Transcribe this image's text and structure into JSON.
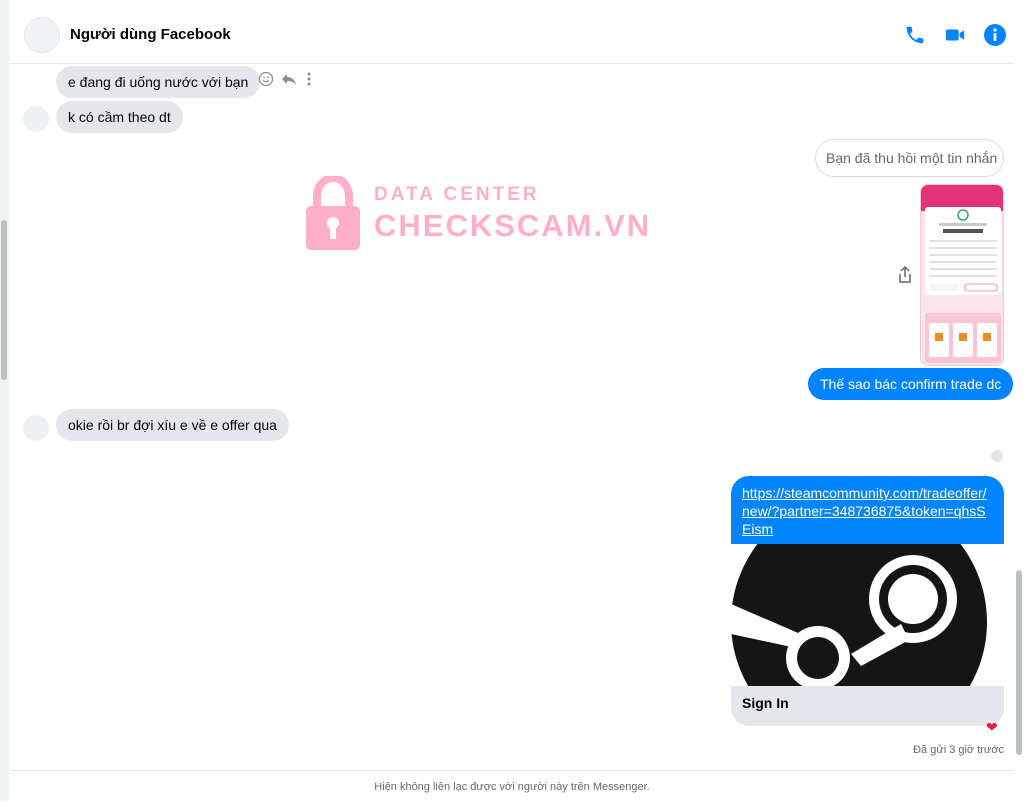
{
  "header": {
    "title": "Người dùng Facebook",
    "icons": [
      "phone-icon",
      "video-icon",
      "info-icon"
    ],
    "accent": "#0084ff"
  },
  "messages": {
    "m1": "e đang đi uống nước với bạn",
    "m2": "k có cầm theo dt",
    "recalled": "Bạn đã thu hồi một tin nhắn",
    "m3": "Thế sao bác confirm trade dc",
    "m4": "okie rồi br đợi xíu e về e offer qua"
  },
  "link_card": {
    "url": "https://steamcommunity.com/tradeoffer/new/?partner=348736875&token=qhsSEism",
    "caption": "Sign In"
  },
  "watermark": {
    "line1": "DATA CENTER",
    "line2": "CHECKSCAM.VN"
  },
  "status": {
    "sent_time": "Đã gửi 3 giờ trước"
  },
  "footer": {
    "notice": "Hiện không liên lạc được với người này trên Messenger."
  },
  "colors": {
    "outgoing": "#0084ff",
    "incoming": "#e4e6eb",
    "reaction": "#e41e3f"
  }
}
